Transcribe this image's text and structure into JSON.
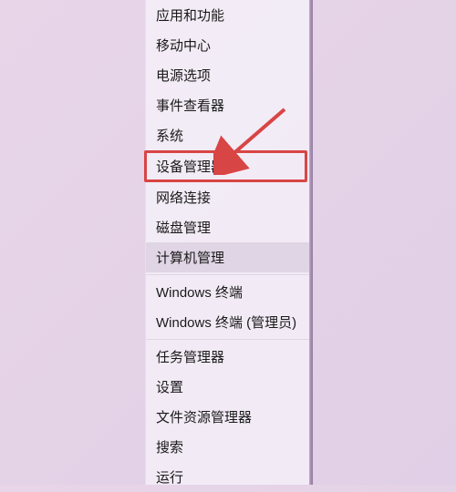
{
  "menu": {
    "items": [
      {
        "label": "应用和功能",
        "separator_after": false
      },
      {
        "label": "移动中心",
        "separator_after": false
      },
      {
        "label": "电源选项",
        "separator_after": false
      },
      {
        "label": "事件查看器",
        "separator_after": false
      },
      {
        "label": "系统",
        "separator_after": false
      },
      {
        "label": "设备管理器",
        "separator_after": false,
        "highlighted": true
      },
      {
        "label": "网络连接",
        "separator_after": false
      },
      {
        "label": "磁盘管理",
        "separator_after": false
      },
      {
        "label": "计算机管理",
        "separator_after": true,
        "hovered": true
      },
      {
        "label": "Windows 终端",
        "separator_after": false
      },
      {
        "label": "Windows 终端 (管理员)",
        "separator_after": true
      },
      {
        "label": "任务管理器",
        "separator_after": false
      },
      {
        "label": "设置",
        "separator_after": false
      },
      {
        "label": "文件资源管理器",
        "separator_after": false
      },
      {
        "label": "搜索",
        "separator_after": false
      },
      {
        "label": "运行",
        "separator_after": false
      }
    ]
  },
  "annotation": {
    "arrow_color": "#d84545",
    "target_item_index": 5
  }
}
